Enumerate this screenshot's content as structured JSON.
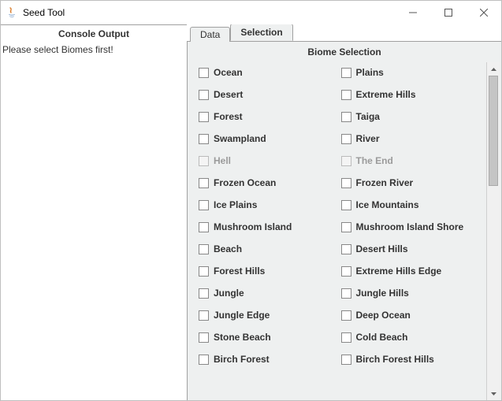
{
  "window": {
    "title": "Seed Tool"
  },
  "left": {
    "header": "Console Output",
    "message": "Please select Biomes first!"
  },
  "tabs": {
    "data": "Data",
    "selection": "Selection"
  },
  "section": {
    "title": "Biome Selection"
  },
  "biomes": {
    "i0": {
      "label": "Ocean",
      "disabled": false
    },
    "i1": {
      "label": "Plains",
      "disabled": false
    },
    "i2": {
      "label": "Desert",
      "disabled": false
    },
    "i3": {
      "label": "Extreme Hills",
      "disabled": false
    },
    "i4": {
      "label": "Forest",
      "disabled": false
    },
    "i5": {
      "label": "Taiga",
      "disabled": false
    },
    "i6": {
      "label": "Swampland",
      "disabled": false
    },
    "i7": {
      "label": "River",
      "disabled": false
    },
    "i8": {
      "label": "Hell",
      "disabled": true
    },
    "i9": {
      "label": "The End",
      "disabled": true
    },
    "i10": {
      "label": "Frozen Ocean",
      "disabled": false
    },
    "i11": {
      "label": "Frozen River",
      "disabled": false
    },
    "i12": {
      "label": "Ice Plains",
      "disabled": false
    },
    "i13": {
      "label": "Ice Mountains",
      "disabled": false
    },
    "i14": {
      "label": "Mushroom Island",
      "disabled": false
    },
    "i15": {
      "label": "Mushroom Island Shore",
      "disabled": false
    },
    "i16": {
      "label": "Beach",
      "disabled": false
    },
    "i17": {
      "label": "Desert Hills",
      "disabled": false
    },
    "i18": {
      "label": "Forest Hills",
      "disabled": false
    },
    "i19": {
      "label": "Extreme Hills Edge",
      "disabled": false
    },
    "i20": {
      "label": "Jungle",
      "disabled": false
    },
    "i21": {
      "label": "Jungle Hills",
      "disabled": false
    },
    "i22": {
      "label": "Jungle Edge",
      "disabled": false
    },
    "i23": {
      "label": "Deep Ocean",
      "disabled": false
    },
    "i24": {
      "label": "Stone Beach",
      "disabled": false
    },
    "i25": {
      "label": "Cold Beach",
      "disabled": false
    },
    "i26": {
      "label": "Birch Forest",
      "disabled": false
    },
    "i27": {
      "label": "Birch Forest Hills",
      "disabled": false
    }
  }
}
